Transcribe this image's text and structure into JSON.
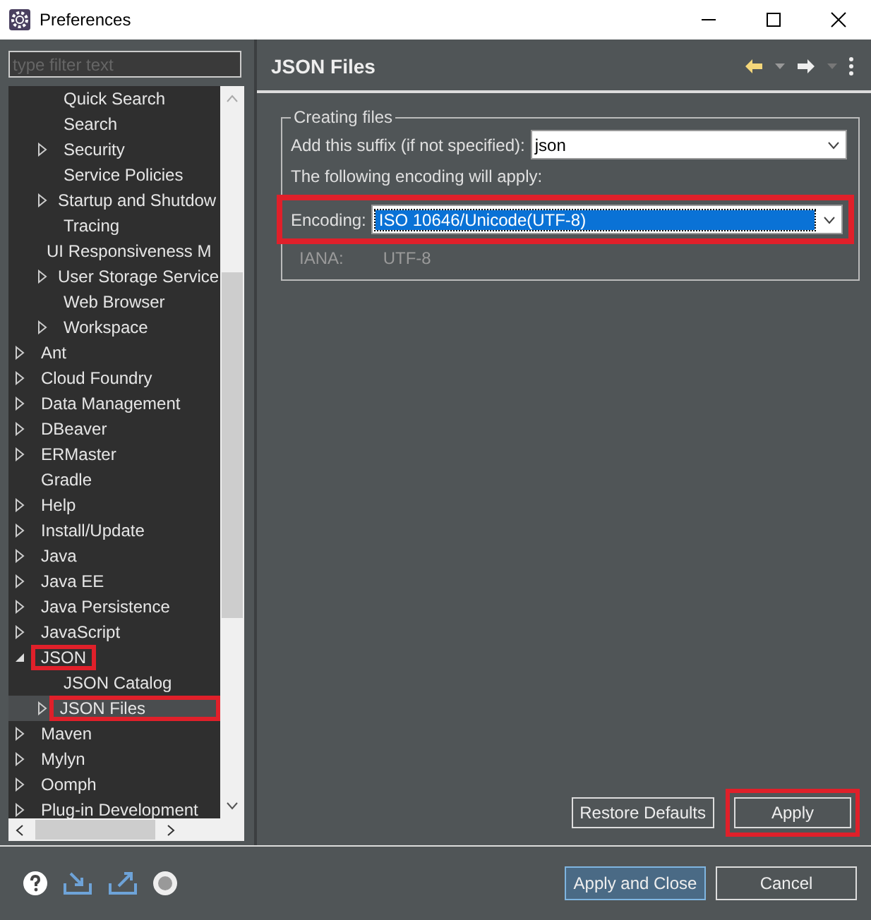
{
  "window": {
    "title": "Preferences"
  },
  "filter": {
    "placeholder": "type filter text"
  },
  "tree": {
    "continued_children": [
      {
        "label": "Quick Search",
        "expandable": false,
        "expanded": false,
        "selected": false,
        "highlighted": false
      },
      {
        "label": "Search",
        "expandable": false,
        "expanded": false,
        "selected": false,
        "highlighted": false
      },
      {
        "label": "Security",
        "expandable": true,
        "expanded": false,
        "selected": false,
        "highlighted": false
      },
      {
        "label": "Service Policies",
        "expandable": false,
        "expanded": false,
        "selected": false,
        "highlighted": false
      },
      {
        "label": "Startup and Shutdow",
        "expandable": true,
        "expanded": false,
        "selected": false,
        "highlighted": false
      },
      {
        "label": "Tracing",
        "expandable": false,
        "expanded": false,
        "selected": false,
        "highlighted": false
      },
      {
        "label": "UI Responsiveness M",
        "expandable": false,
        "expanded": false,
        "selected": false,
        "highlighted": false
      },
      {
        "label": "User Storage Service",
        "expandable": true,
        "expanded": false,
        "selected": false,
        "highlighted": false
      },
      {
        "label": "Web Browser",
        "expandable": false,
        "expanded": false,
        "selected": false,
        "highlighted": false
      },
      {
        "label": "Workspace",
        "expandable": true,
        "expanded": false,
        "selected": false,
        "highlighted": false
      }
    ],
    "items": [
      {
        "label": "Ant",
        "expandable": true,
        "expanded": false,
        "selected": false,
        "highlighted": false
      },
      {
        "label": "Cloud Foundry",
        "expandable": true,
        "expanded": false,
        "selected": false,
        "highlighted": false
      },
      {
        "label": "Data Management",
        "expandable": true,
        "expanded": false,
        "selected": false,
        "highlighted": false
      },
      {
        "label": "DBeaver",
        "expandable": true,
        "expanded": false,
        "selected": false,
        "highlighted": false
      },
      {
        "label": "ERMaster",
        "expandable": true,
        "expanded": false,
        "selected": false,
        "highlighted": false
      },
      {
        "label": "Gradle",
        "expandable": false,
        "expanded": false,
        "selected": false,
        "highlighted": false
      },
      {
        "label": "Help",
        "expandable": true,
        "expanded": false,
        "selected": false,
        "highlighted": false
      },
      {
        "label": "Install/Update",
        "expandable": true,
        "expanded": false,
        "selected": false,
        "highlighted": false
      },
      {
        "label": "Java",
        "expandable": true,
        "expanded": false,
        "selected": false,
        "highlighted": false
      },
      {
        "label": "Java EE",
        "expandable": true,
        "expanded": false,
        "selected": false,
        "highlighted": false
      },
      {
        "label": "Java Persistence",
        "expandable": true,
        "expanded": false,
        "selected": false,
        "highlighted": false
      },
      {
        "label": "JavaScript",
        "expandable": true,
        "expanded": false,
        "selected": false,
        "highlighted": false
      },
      {
        "label": "JSON",
        "expandable": true,
        "expanded": true,
        "selected": false,
        "highlighted": true,
        "children": [
          {
            "label": "JSON Catalog",
            "expandable": false,
            "expanded": false,
            "selected": false,
            "highlighted": false
          },
          {
            "label": "JSON Files",
            "expandable": true,
            "expanded": false,
            "selected": true,
            "highlighted": true
          }
        ]
      },
      {
        "label": "Maven",
        "expandable": true,
        "expanded": false,
        "selected": false,
        "highlighted": false
      },
      {
        "label": "Mylyn",
        "expandable": true,
        "expanded": false,
        "selected": false,
        "highlighted": false
      },
      {
        "label": "Oomph",
        "expandable": true,
        "expanded": false,
        "selected": false,
        "highlighted": false
      },
      {
        "label": "Plug-in Development",
        "expandable": true,
        "expanded": false,
        "selected": false,
        "highlighted": false
      }
    ]
  },
  "page": {
    "title": "JSON Files",
    "group": {
      "title": "Creating files",
      "suffix_label": "Add this suffix (if not specified):",
      "suffix_value": "json",
      "note": "The following encoding will apply:",
      "encoding_label": "Encoding:",
      "encoding_value": "ISO 10646/Unicode(UTF-8)",
      "encoding_highlighted": true,
      "iana_label": "IANA:",
      "iana_value": "UTF-8"
    },
    "buttons": [
      {
        "label": "Restore Defaults",
        "highlighted": false
      },
      {
        "label": "Apply",
        "highlighted": true
      }
    ]
  },
  "dialog_buttons": [
    {
      "label": "Apply and Close",
      "default": true
    },
    {
      "label": "Cancel",
      "default": false
    }
  ]
}
